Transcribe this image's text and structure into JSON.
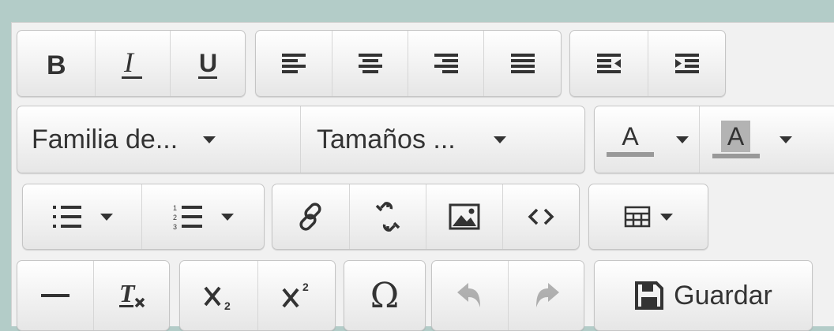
{
  "toolbar": {
    "font_family_label": "Familia de...",
    "font_size_label": "Tamaños ...",
    "text_color_glyph": "A",
    "background_color_glyph": "A",
    "save_label": "Guardar",
    "special_char_glyph": "Ω"
  },
  "colors": {
    "background": "#b3ccc8",
    "toolbar": "#f1f1f1",
    "icon": "#333333",
    "color_bar": "#999999",
    "bgcolor_highlight": "#b3b3b3"
  },
  "buttons": {
    "row1": [
      "bold-icon",
      "italic-icon",
      "underline-icon",
      "align-left-icon",
      "align-center-icon",
      "align-right-icon",
      "align-justify-icon",
      "outdent-icon",
      "indent-icon"
    ],
    "row3": [
      "bullet-list-icon",
      "numbered-list-icon",
      "link-icon",
      "unlink-icon",
      "image-icon",
      "code-icon",
      "table-icon"
    ],
    "row4": [
      "horizontal-rule-icon",
      "remove-format-icon",
      "subscript-icon",
      "superscript-icon",
      "special-character-icon",
      "undo-icon",
      "redo-icon",
      "save-icon"
    ]
  }
}
